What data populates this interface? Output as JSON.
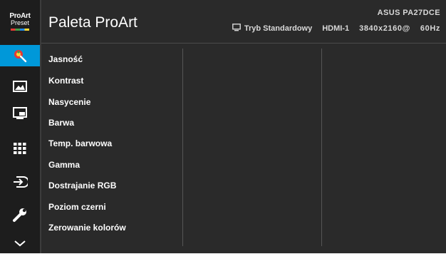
{
  "logo": {
    "line1": "ProArt",
    "line2": "Preset"
  },
  "header": {
    "title": "Paleta ProArt",
    "model": "ASUS PA27DCE",
    "mode": "Tryb Standardowy",
    "input": "HDMI-1",
    "resolution": "3840x2160@",
    "refresh": "60Hz"
  },
  "rail": {
    "items": [
      {
        "icon": "palette-icon",
        "active": true
      },
      {
        "icon": "image-icon",
        "active": false
      },
      {
        "icon": "pip-icon",
        "active": false
      },
      {
        "icon": "grid-icon",
        "active": false
      },
      {
        "icon": "input-select-icon",
        "active": false
      },
      {
        "icon": "wrench-icon",
        "active": false
      },
      {
        "icon": "chevron-down-icon",
        "active": false
      }
    ]
  },
  "menu": {
    "items": [
      "Jasność",
      "Kontrast",
      "Nasycenie",
      "Barwa",
      "Temp. barwowa",
      "Gamma",
      "Dostrajanie RGB",
      "Poziom czerni",
      "Zerowanie kolorów"
    ]
  },
  "colors": {
    "accent": "#0098d9",
    "background": "#2a2a2a",
    "rail": "#1d1d1d"
  }
}
